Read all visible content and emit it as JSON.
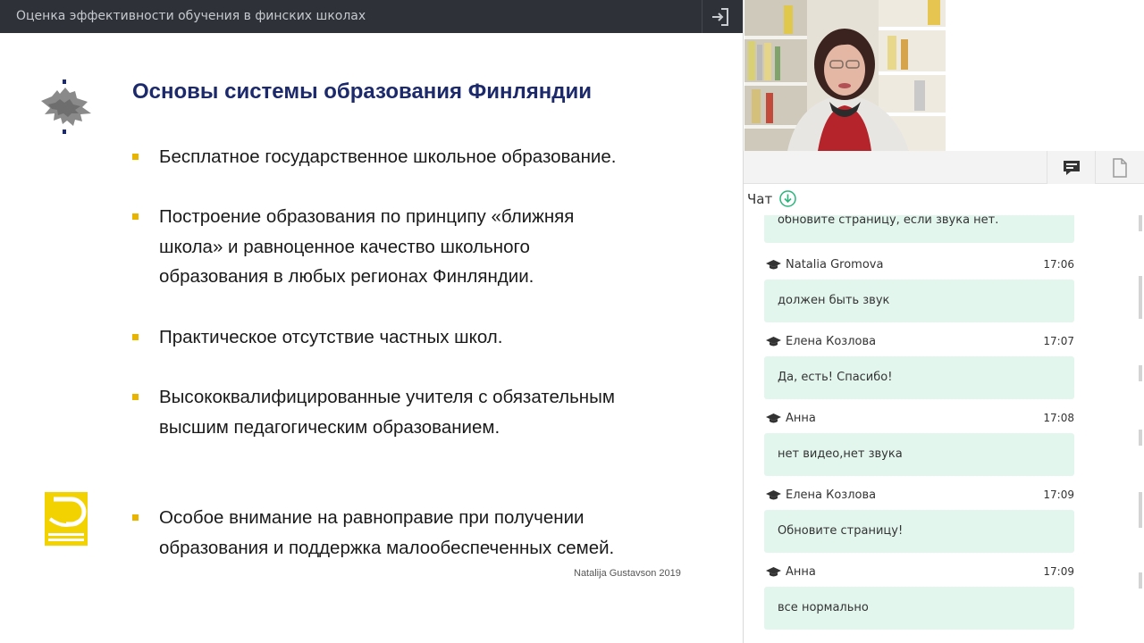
{
  "topbar": {
    "title": "Оценка эффективности обучения в финских школах",
    "exit_icon": "sign-in-icon"
  },
  "slide": {
    "title": "Основы системы образования Финляндии",
    "bullets": [
      [
        "Бесплатное государственное школьное образование."
      ],
      [
        "Построение образования по принципу «ближняя",
        "школа» и равноценное качество школьного",
        "образования в любых регионах Финляндии."
      ],
      [
        "Практическое отсутствие частных школ."
      ],
      [
        "Высококвалифицированные учителя с обязательным",
        "высшим педагогическим образованием."
      ],
      [
        "Особое внимание на равноправие при получении",
        "образования и поддержка малообеспеченных семей."
      ]
    ],
    "credit": "Natalija Gustavson 2019",
    "accent_color": "#e9b400",
    "title_color": "#1c2a6b"
  },
  "panel": {
    "chat_tab_icon": "chat-bubble-icon",
    "files_tab_icon": "document-icon",
    "chat_label": "Чат",
    "download_icon": "download-circle-icon"
  },
  "chat": {
    "partial_message": "обновите страницу, если звука нет.",
    "messages": [
      {
        "author": "Natalia Gromova",
        "time": "17:06",
        "text": "должен быть звук"
      },
      {
        "author": "Елена Козлова",
        "time": "17:07",
        "text": "Да, есть! Спасибо!"
      },
      {
        "author": "Анна",
        "time": "17:08",
        "text": "нет видео,нет звука"
      },
      {
        "author": "Елена Козлова",
        "time": "17:09",
        "text": "Обновите страницу!"
      },
      {
        "author": "Анна",
        "time": "17:09",
        "text": "все нормально"
      }
    ],
    "bubble_color": "#e3f6ee"
  }
}
